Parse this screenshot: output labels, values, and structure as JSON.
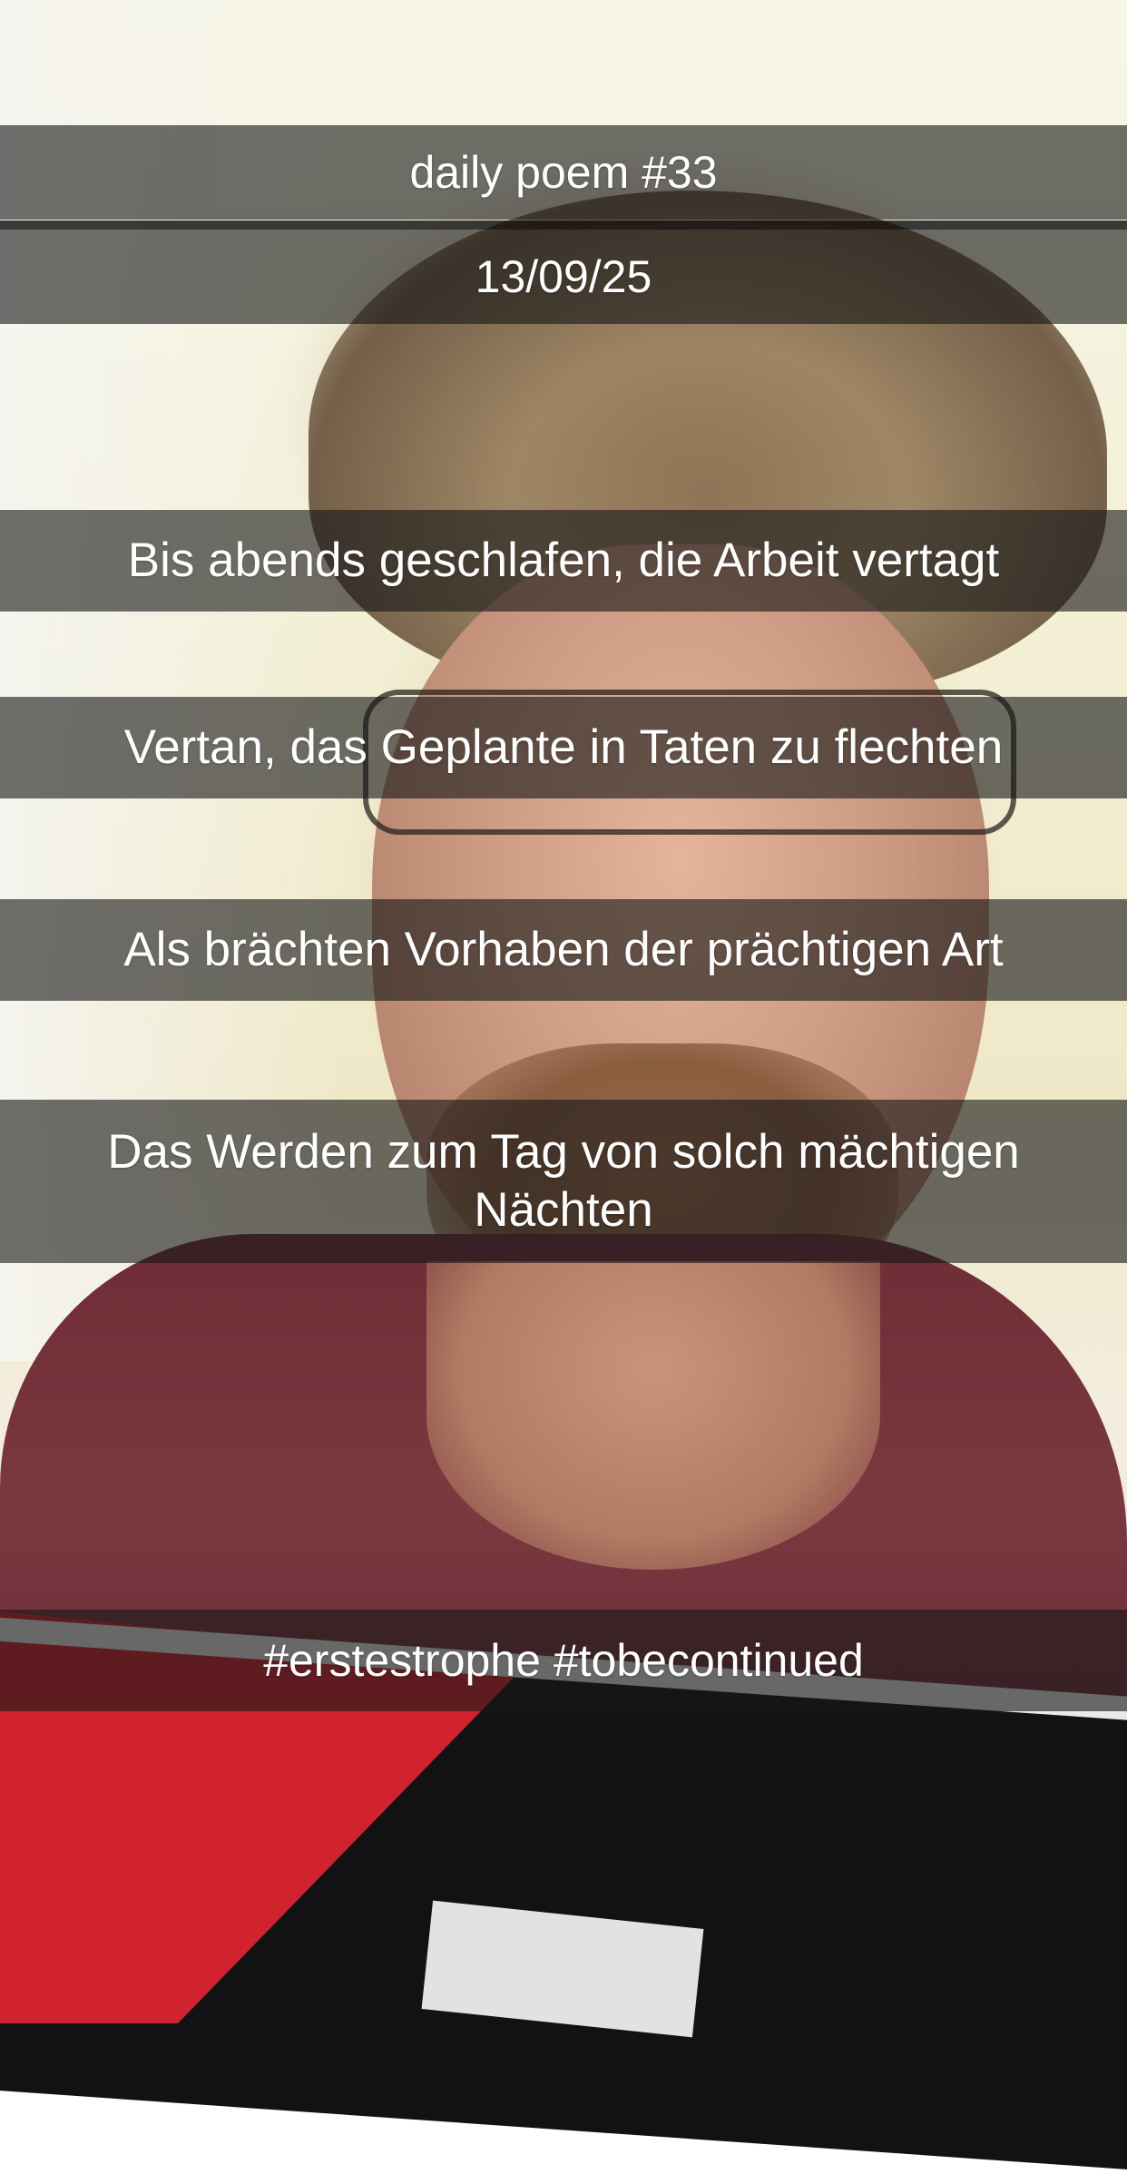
{
  "header": {
    "title": "daily poem #33",
    "date": "13/09/25"
  },
  "poem": {
    "lines": [
      "Bis abends geschlafen, die Arbeit vertagt",
      "Vertan, das Geplante in Taten zu flechten",
      "Als brächten Vorhaben der prächtigen Art",
      "Das Werden zum Tag von solch mächtigen Nächten"
    ]
  },
  "footer": {
    "hashtags": "#erstestrophe #tobecontinued"
  }
}
